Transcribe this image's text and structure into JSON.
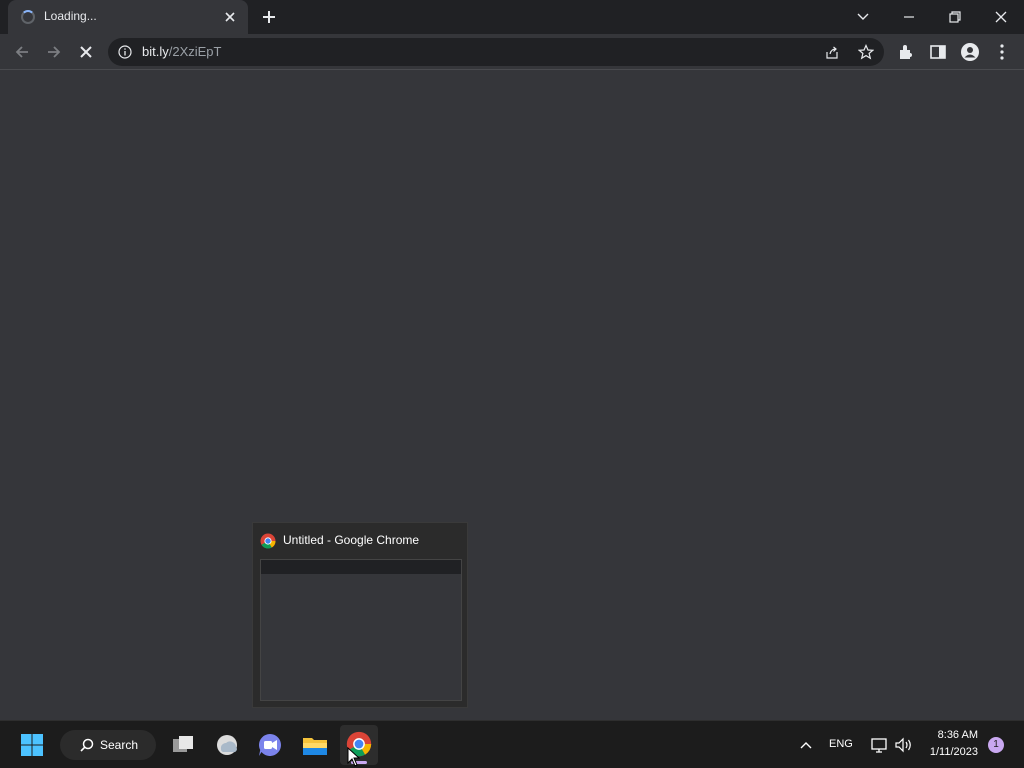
{
  "browser": {
    "tab": {
      "title": "Loading..."
    },
    "url": {
      "host": "bit.ly",
      "path": "/2XziEpT"
    }
  },
  "taskbar": {
    "search_label": "Search",
    "system_tray": {
      "language": "ENG",
      "time": "8:36 AM",
      "date": "1/11/2023",
      "notification_count": "1"
    },
    "preview": {
      "title": "Untitled - Google Chrome"
    }
  }
}
